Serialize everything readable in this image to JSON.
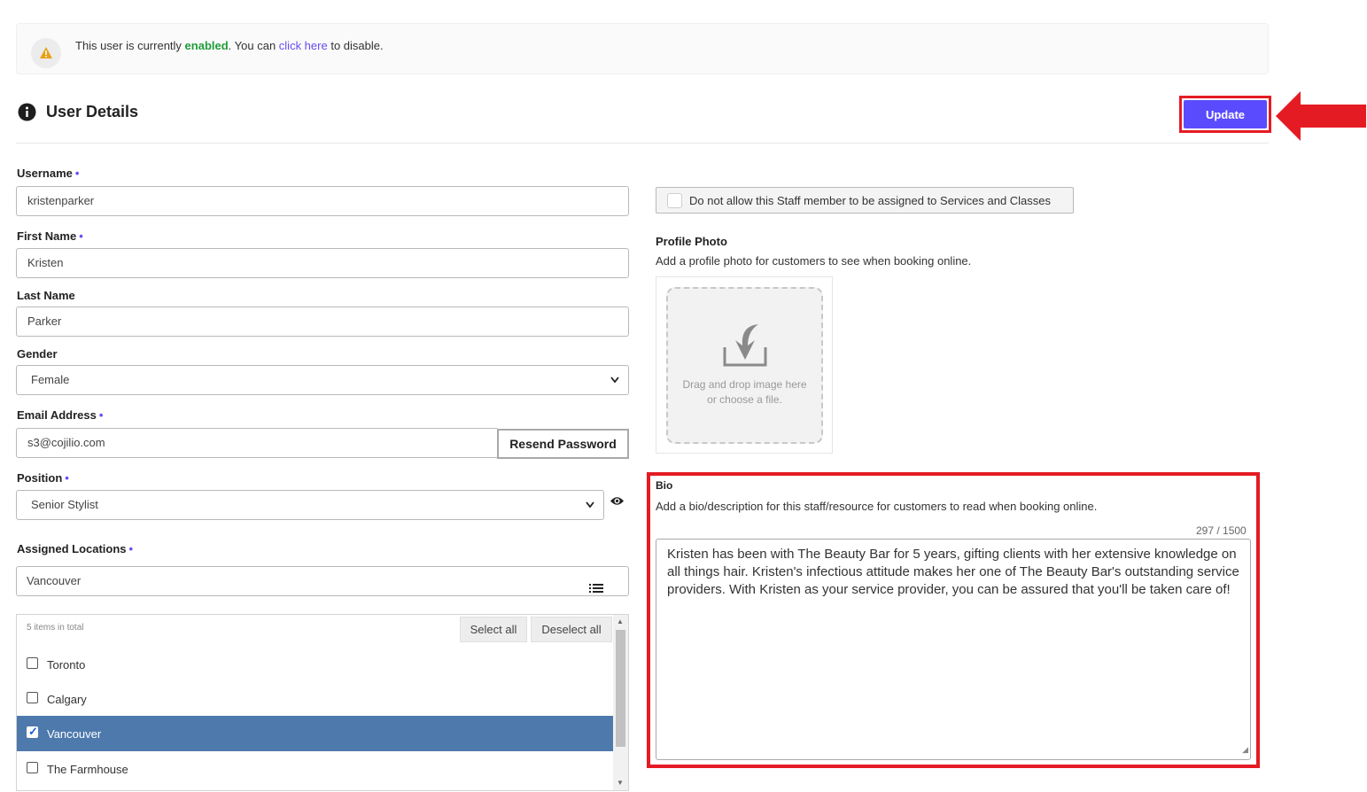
{
  "notice": {
    "text_prefix": "This user is currently",
    "status": "enabled",
    "text_middle": ". You can",
    "link": "click here",
    "text_suffix": "to disable."
  },
  "header": {
    "title": "User Details",
    "update_label": "Update"
  },
  "form": {
    "username": {
      "label": "Username",
      "value": "kristenparker"
    },
    "first_name": {
      "label": "First Name",
      "value": "Kristen"
    },
    "last_name": {
      "label": "Last Name",
      "value": "Parker"
    },
    "gender": {
      "label": "Gender",
      "value": "Female"
    },
    "email": {
      "label": "Email Address",
      "value": "s3@cojilio.com",
      "resend_label": "Resend Password"
    },
    "position": {
      "label": "Position",
      "value": "Senior Stylist"
    },
    "locations": {
      "label": "Assigned Locations",
      "value": "Vancouver",
      "count_text": "5 items in total",
      "select_all": "Select all",
      "deselect_all": "Deselect all",
      "items": [
        {
          "label": "Toronto",
          "checked": false
        },
        {
          "label": "Calgary",
          "checked": false
        },
        {
          "label": "Vancouver",
          "checked": true
        },
        {
          "label": "The Farmhouse",
          "checked": false
        }
      ]
    }
  },
  "right": {
    "staff_checkbox_label": "Do not allow this Staff member to be assigned to Services and Classes",
    "profile_photo": {
      "title": "Profile Photo",
      "desc": "Add a profile photo for customers to see when booking online.",
      "drop_line1": "Drag and drop image here",
      "drop_line2": "or choose a file."
    },
    "bio": {
      "title": "Bio",
      "desc": "Add a bio/description for this staff/resource for customers to read when booking online.",
      "counter": "297 / 1500",
      "text": "Kristen has been with The Beauty Bar for 5 years, gifting clients with her extensive knowledge on all things hair. Kristen's infectious attitude makes her one of The Beauty Bar's outstanding service providers. With Kristen as your service provider, you can be assured that you'll be taken care of!"
    }
  },
  "colors": {
    "accent": "#5b4bff",
    "highlight": "#e51b23",
    "enabled": "#1f9d3a",
    "selected_row": "#4e79ac"
  }
}
